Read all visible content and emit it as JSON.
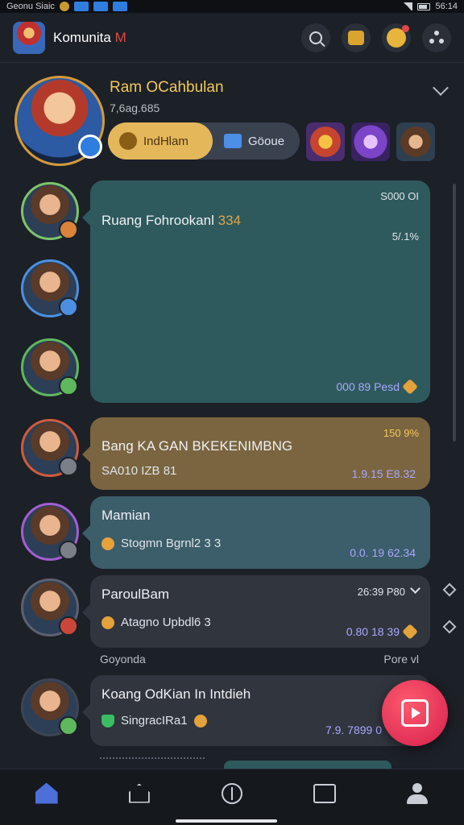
{
  "status_bar": {
    "left_text": "Geonu Siaic",
    "time": "56:14"
  },
  "app_bar": {
    "title": "Komunita",
    "title_accent": "M"
  },
  "profile": {
    "name": "Ram OCahbulan",
    "subtitle": "7,6ag.685",
    "gold_pill_label": "IndHlam",
    "alt_pill_label": "Göoue"
  },
  "feed": [
    {
      "title": "Ruang Fohrookanl",
      "title_highlight": "334",
      "meta_top": "S000 OI",
      "meta_pct": "5/.1%",
      "footer": "000 89 Pesd"
    },
    {
      "title": "Bang KA GAN BKEKENIMBNG",
      "line": "SA010 IZB 81",
      "meta_top": "150 9%",
      "footer": "1.9.15 E8.32"
    },
    {
      "title": "Mamian",
      "line": "Stogmn Bgrnl2 3 3",
      "footer": "0.0. 19 62.34"
    },
    {
      "title": "ParoulBam",
      "meta_top": "26:39 P80",
      "line": "Atagno Upbdl6 3",
      "footer": "0.80 18 39"
    },
    {
      "title": "Koang OdKian In Intdieh",
      "line": "SingracIRa1",
      "footer": "7.9. 7899 0"
    }
  ],
  "sections": {
    "label_left": "Goyonda",
    "label_right": "Pore vl"
  }
}
